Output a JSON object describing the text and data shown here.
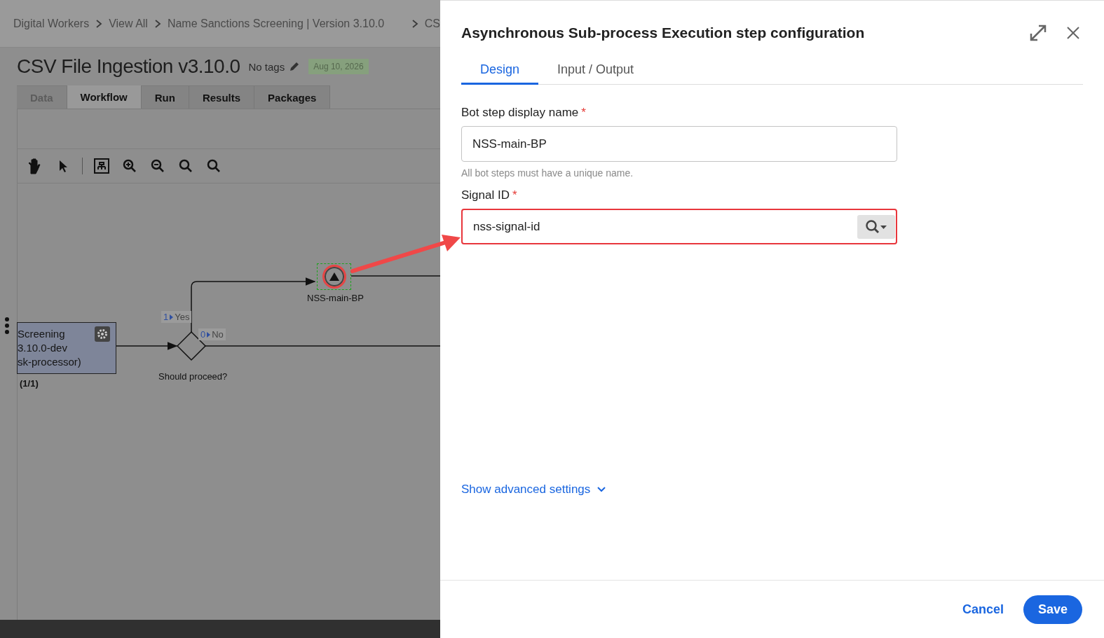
{
  "breadcrumb": [
    "Digital Workers",
    "View All",
    "Name Sanctions Screening | Version 3.10.0",
    "CS"
  ],
  "page": {
    "title": "CSV File Ingestion v3.10.0",
    "tags_label": "No tags",
    "date_badge": "Aug 10, 2026"
  },
  "tabs": [
    {
      "label": "Data",
      "selected": false,
      "disabled": true
    },
    {
      "label": "Workflow",
      "selected": true,
      "disabled": false
    },
    {
      "label": "Run",
      "selected": false,
      "disabled": false
    },
    {
      "label": "Results",
      "selected": false,
      "disabled": false
    },
    {
      "label": "Packages",
      "selected": false,
      "disabled": false
    }
  ],
  "diagram": {
    "task_node": {
      "lines": [
        "Screening",
        "3.10.0-dev",
        "sk-processor)"
      ],
      "count": "(1/1)"
    },
    "gateway": {
      "label": "Should proceed?",
      "branches": [
        {
          "index": "1",
          "label": "Yes"
        },
        {
          "index": "0",
          "label": "No"
        }
      ]
    },
    "signal_node": {
      "label": "NSS-main-BP",
      "selected": true,
      "highlighted": true
    }
  },
  "callout_arrow": true,
  "panel": {
    "title": "Asynchronous Sub-process Execution step configuration",
    "tabs": [
      {
        "label": "Design",
        "selected": true
      },
      {
        "label": "Input / Output",
        "selected": false
      }
    ],
    "fields": [
      {
        "kind": "text",
        "label": "Bot step display name",
        "required_mark": "*",
        "value": "NSS-main-BP",
        "hint": "All bot steps must have a unique name.",
        "highlighted": false
      },
      {
        "kind": "lookup",
        "label": "Signal ID",
        "required_mark": "*",
        "value": "nss-signal-id",
        "highlighted": true
      }
    ],
    "advanced_link": "Show advanced settings",
    "buttons": [
      {
        "kind": "secondary",
        "label": "Cancel"
      },
      {
        "kind": "primary",
        "label": "Save"
      }
    ]
  }
}
